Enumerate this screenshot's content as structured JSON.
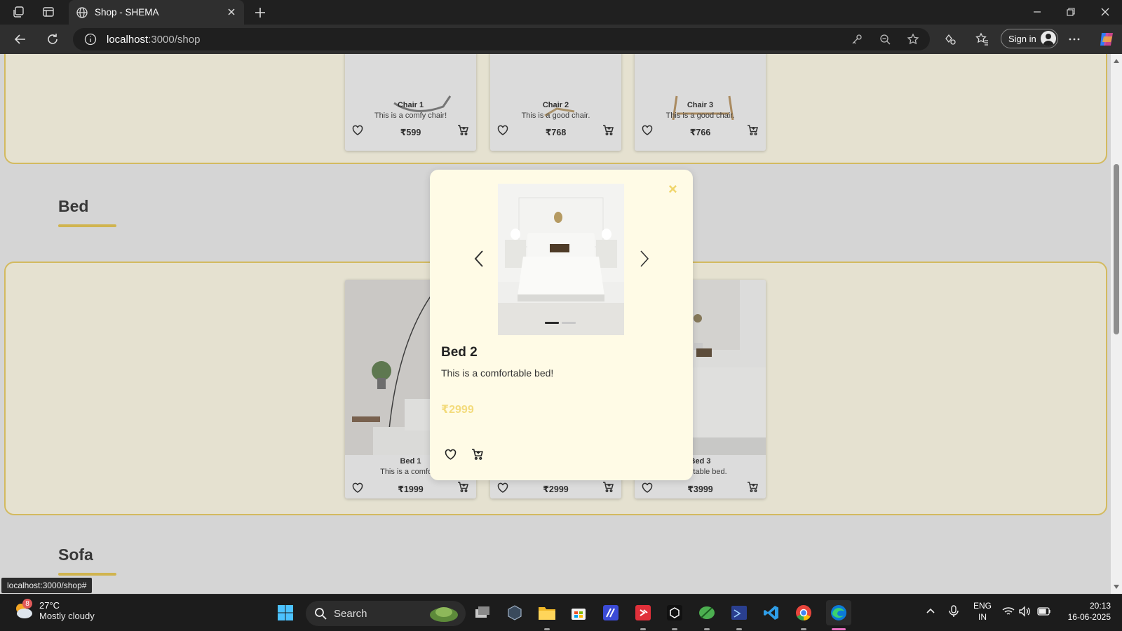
{
  "browser": {
    "tab_title": "Shop - SHEMA",
    "url_host": "localhost",
    "url_rest": ":3000/shop",
    "sign_in_label": "Sign in"
  },
  "sections": {
    "chairs": {
      "products": [
        {
          "name": "Chair 1",
          "desc": "This is a comfy chair!",
          "price": "₹599"
        },
        {
          "name": "Chair 2",
          "desc": "This is a good chair.",
          "price": "₹768"
        },
        {
          "name": "Chair 3",
          "desc": "This is a good chair.",
          "price": "₹766"
        }
      ]
    },
    "bed": {
      "title": "Bed",
      "products": [
        {
          "name": "Bed 1",
          "desc": "This is a comforta",
          "price": "₹1999"
        },
        {
          "name": "",
          "desc": "",
          "price": "₹2999"
        },
        {
          "name": "Bed 3",
          "desc": "omfortable bed.",
          "price": "₹3999"
        }
      ]
    },
    "sofa": {
      "title": "Sofa"
    }
  },
  "modal": {
    "close_label": "×",
    "title": "Bed 2",
    "description": "This is a comfortable bed!",
    "price": "₹2999",
    "carousel_dots": 2,
    "active_dot": 0
  },
  "status_link": "localhost:3000/shop#",
  "taskbar": {
    "weather_badge": "8",
    "temperature": "27°C",
    "condition": "Mostly cloudy",
    "search_label": "Search",
    "lang_top": "ENG",
    "lang_bottom": "IN",
    "time": "20:13",
    "date": "16-06-2025"
  },
  "colors": {
    "accent_yellow": "#eacb5c",
    "band_bg": "#fffbe6",
    "price_yellow": "#f3db7c"
  }
}
